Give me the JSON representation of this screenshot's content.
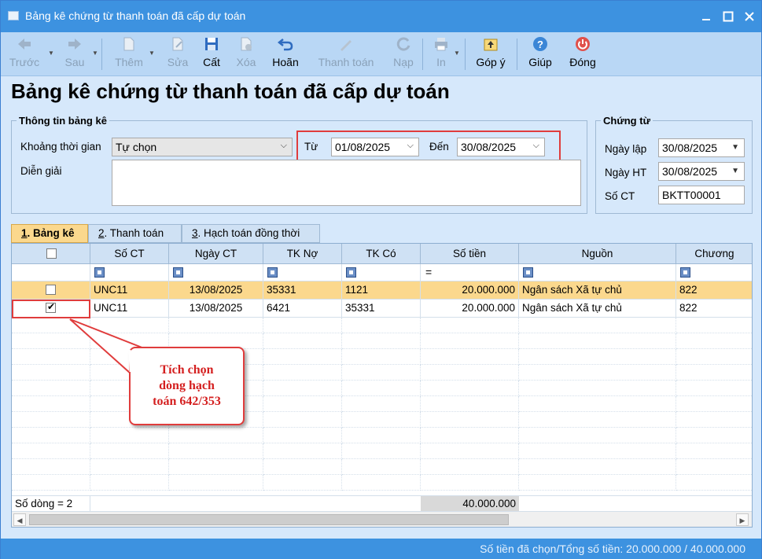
{
  "window": {
    "title": "Bảng kê chứng từ thanh toán đã cấp dự toán"
  },
  "toolbar": {
    "prev": "Trước",
    "next": "Sau",
    "add": "Thêm",
    "edit": "Sửa",
    "save": "Cất",
    "delete": "Xóa",
    "undo": "Hoãn",
    "pay": "Thanh toán",
    "reload": "Nạp",
    "print": "In",
    "feedback": "Góp ý",
    "help": "Giúp",
    "close": "Đóng"
  },
  "page": {
    "title": "Bảng kê chứng từ thanh toán đã cấp dự toán"
  },
  "info": {
    "legend": "Thông tin bảng kê",
    "period_label": "Khoảng thời gian",
    "period_value": "Tự chọn",
    "from_label": "Từ",
    "from_value": "01/08/2025",
    "to_label": "Đến",
    "to_value": "30/08/2025",
    "desc_label": "Diễn giải",
    "desc_value": ""
  },
  "voucher": {
    "legend": "Chứng từ",
    "date_label": "Ngày lập",
    "date_value": "30/08/2025",
    "acc_date_label": "Ngày HT",
    "acc_date_value": "30/08/2025",
    "no_label": "Số CT",
    "no_value": "BKTT00001"
  },
  "tabs": [
    {
      "key": "1",
      "label": ". Bảng kê"
    },
    {
      "key": "2",
      "label": ". Thanh toán"
    },
    {
      "key": "3",
      "label": ". Hạch toán đồng thời"
    }
  ],
  "grid": {
    "columns": [
      "Số CT",
      "Ngày CT",
      "TK Nợ",
      "TK Có",
      "Số tiền",
      "Nguồn",
      "Chương"
    ],
    "rows": [
      {
        "checked": false,
        "so_ct": "UNC11",
        "ngay_ct": "13/08/2025",
        "tk_no": "35331",
        "tk_co": "1121",
        "so_tien": "20.000.000",
        "nguon": "Ngân sách Xã tự chủ",
        "chuong": "822"
      },
      {
        "checked": true,
        "so_ct": "UNC11",
        "ngay_ct": "13/08/2025",
        "tk_no": "6421",
        "tk_co": "35331",
        "so_tien": "20.000.000",
        "nguon": "Ngân sách Xã tự chủ",
        "chuong": "822"
      }
    ],
    "row_count": "Số dòng = 2",
    "total": "40.000.000"
  },
  "callout": {
    "line1": "Tích chọn",
    "line2": "dòng hạch",
    "line3": "toán 642/353"
  },
  "status": {
    "text": "Số tiền đã chọn/Tổng số tiền: 20.000.000 / 40.000.000"
  },
  "colors": {
    "titlebar": "#3d92e0",
    "selected_row": "#fbd88d",
    "highlight": "#e03c3c"
  }
}
